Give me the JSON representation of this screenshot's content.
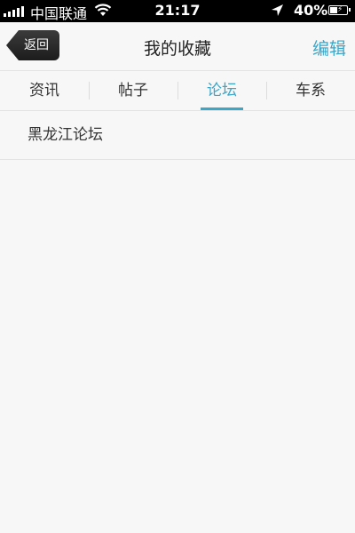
{
  "status_bar": {
    "carrier": "中国联通",
    "time": "21:17",
    "battery_percent": "40%"
  },
  "nav": {
    "back_label": "返回",
    "title": "我的收藏",
    "edit_label": "编辑"
  },
  "tabs": [
    {
      "label": "资讯"
    },
    {
      "label": "帖子"
    },
    {
      "label": "论坛"
    },
    {
      "label": "车系"
    }
  ],
  "active_tab": 2,
  "list": [
    {
      "label": "黑龙江论坛"
    }
  ],
  "colors": {
    "accent": "#3aa6c8",
    "status_bar_bg": "#000000",
    "page_bg": "#f7f7f7"
  },
  "icons": [
    "signal-icon",
    "wifi-icon",
    "location-arrow-icon",
    "battery-icon"
  ]
}
